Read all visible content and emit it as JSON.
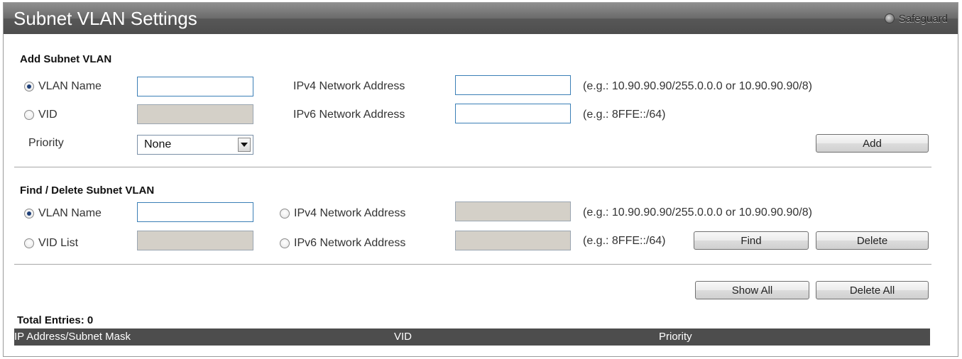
{
  "title": "Subnet VLAN Settings",
  "safeguard": {
    "label": "Safeguard"
  },
  "add_section": {
    "heading": "Add Subnet VLAN",
    "vlan_name_label": "VLAN Name",
    "vlan_name_value": "",
    "vid_label": "VID",
    "vid_value": "",
    "priority_label": "Priority",
    "priority_value": "None",
    "ipv4_label": "IPv4 Network Address",
    "ipv4_value": "",
    "ipv4_hint": "(e.g.: 10.90.90.90/255.0.0.0 or 10.90.90.90/8)",
    "ipv6_label": "IPv6 Network Address",
    "ipv6_value": "",
    "ipv6_hint": "(e.g.: 8FFE::/64)",
    "add_button": "Add"
  },
  "find_section": {
    "heading": "Find / Delete Subnet VLAN",
    "vlan_name_label": "VLAN Name",
    "vlan_name_value": "",
    "vid_list_label": "VID List",
    "vid_list_value": "",
    "ipv4_label": "IPv4 Network Address",
    "ipv4_value": "",
    "ipv4_hint": "(e.g.: 10.90.90.90/255.0.0.0 or 10.90.90.90/8)",
    "ipv6_label": "IPv6 Network Address",
    "ipv6_value": "",
    "ipv6_hint": "(e.g.: 8FFE::/64)",
    "find_button": "Find",
    "delete_button": "Delete"
  },
  "actions": {
    "show_all_button": "Show All",
    "delete_all_button": "Delete All"
  },
  "table": {
    "total_entries": "Total Entries: 0",
    "columns": [
      "IP Address/Subnet Mask",
      "VID",
      "Priority"
    ]
  },
  "colors": {
    "header_bg": "#4d4d4d",
    "input_border": "#3b7fb6",
    "disabled_bg": "#d4d0c8"
  }
}
